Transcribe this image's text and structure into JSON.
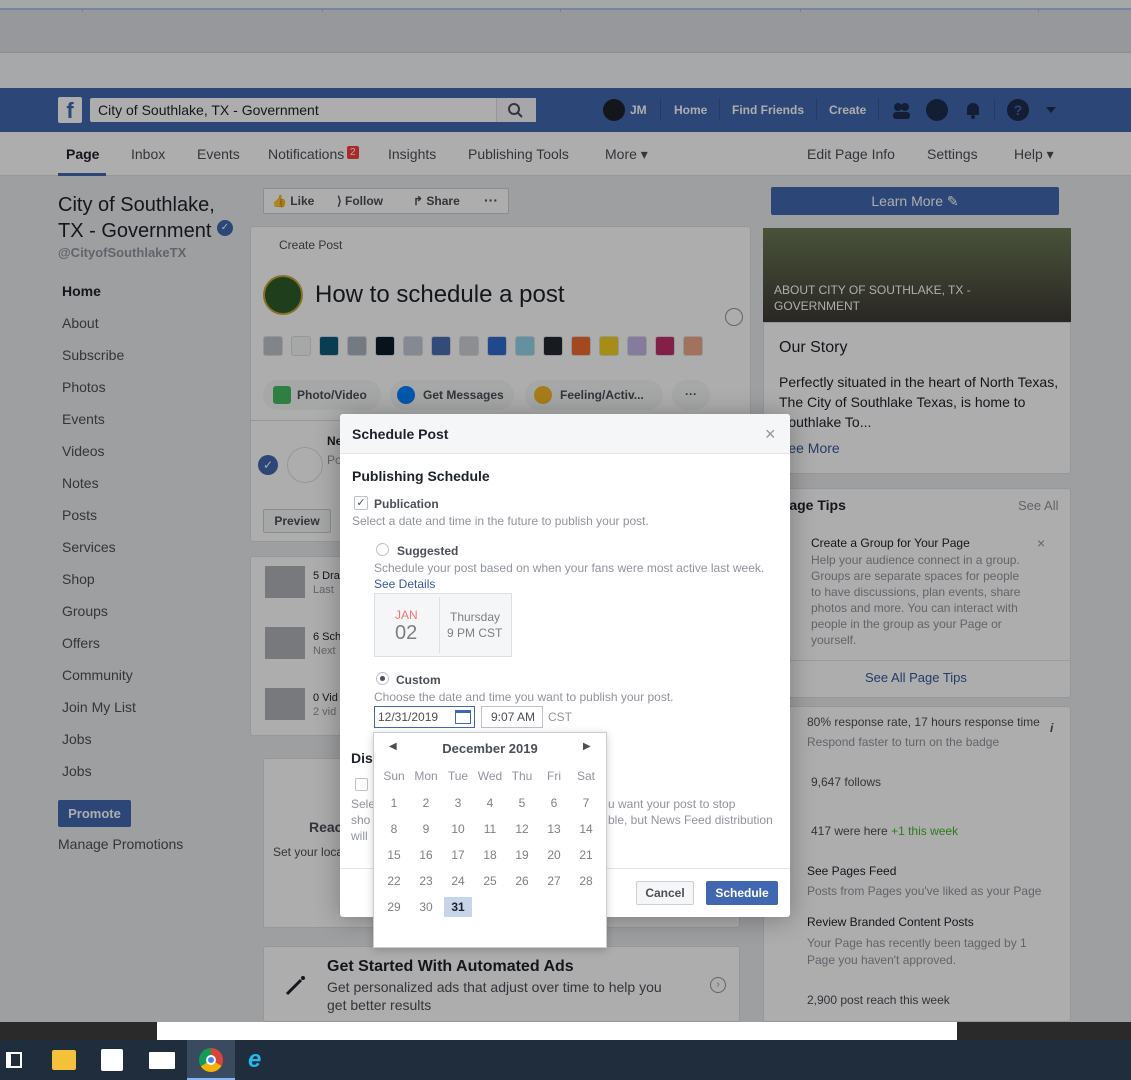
{
  "fb": {
    "search_value": "City of Southlake, TX - Government",
    "initials": "JM",
    "home": "Home",
    "find_friends": "Find Friends",
    "create": "Create"
  },
  "tabs": {
    "page": "Page",
    "inbox": "Inbox",
    "events": "Events",
    "notifications": "Notifications",
    "notif_count": "2",
    "insights": "Insights",
    "publishing": "Publishing Tools",
    "more": "More ▾",
    "edit_info": "Edit Page Info",
    "settings": "Settings",
    "help": "Help ▾"
  },
  "left": {
    "title": "City of Southlake, TX - Government",
    "handle": "@CityofSouthlakeTX",
    "nav": [
      "Home",
      "About",
      "Subscribe",
      "Photos",
      "Events",
      "Videos",
      "Notes",
      "Posts",
      "Services",
      "Shop",
      "Groups",
      "Offers",
      "Community",
      "Join My List",
      "Jobs",
      "Jobs"
    ],
    "promote": "Promote",
    "manage": "Manage Promotions"
  },
  "actions": {
    "like": "Like",
    "follow": "Follow",
    "share": "Share",
    "more": "···"
  },
  "post": {
    "header": "Create Post",
    "text": "How to schedule a post",
    "photo": "Photo/Video",
    "messages": "Get Messages",
    "feeling": "Feeling/Activ...",
    "more": "···",
    "preview": "Preview",
    "news_label": "Ne",
    "pos_label": "Po"
  },
  "feed": {
    "drafts": "5 Dra",
    "drafts_sub": "Last",
    "sched": "6 Sch",
    "sched_sub": "Next",
    "videos": "0 Vid",
    "videos_sub": "2 vid",
    "reach": "Reac",
    "reach_sub": "Set your loca",
    "ads_title": "Get Started With Automated Ads",
    "ads_sub": "Get personalized ads that adjust over time to help you get better results"
  },
  "right": {
    "learn_more": "Learn More",
    "about_banner": "ABOUT CITY OF SOUTHLAKE, TX - GOVERNMENT",
    "our_story": "Our Story",
    "story_text": "Perfectly situated in the heart of North Texas, The City of Southlake Texas, is home to Southlake To...",
    "see_more": "See More",
    "tips_title": "Page Tips",
    "see_all": "See All",
    "tip_title": "Create a Group for Your Page",
    "tip_text": "Help your audience connect in a group. Groups are separate spaces for people to have discussions, plan events, share photos and more. You can interact with people in the group as your Page or yourself.",
    "see_all_tips": "See All Page Tips",
    "response": "80% response rate, 17 hours response time",
    "response_sub": "Respond faster to turn on the badge",
    "follows": "9,647 follows",
    "were_here": "417 were here",
    "this_week": "+1 this week",
    "see_feed": "See Pages Feed",
    "see_feed_sub": "Posts from Pages you've liked as your Page",
    "review": "Review Branded Content Posts",
    "review_sub": "Your Page has recently been tagged by 1 Page you haven't approved.",
    "reach": "2,900 post reach this week"
  },
  "modal": {
    "title": "Schedule Post",
    "close": "×",
    "section": "Publishing Schedule",
    "publication": "Publication",
    "pub_help": "Select a date and time in the future to publish your post.",
    "suggested": "Suggested",
    "sugg_help": "Schedule your post based on when your fans were most active last week.",
    "see_details": "See Details",
    "sugg_month": "JAN",
    "sugg_day": "02",
    "sugg_weekday": "Thursday",
    "sugg_time": "9 PM CST",
    "custom": "Custom",
    "custom_help": "Choose the date and time you want to publish your post.",
    "date_value": "12/31/2019",
    "time_value": "9:07 AM",
    "tz": "CST",
    "dis_label": "Dis",
    "partial_1": "u want your post to stop",
    "partial_2": "ble, but News Feed distribution",
    "partial_sel": "Sele",
    "partial_sho": "sho",
    "partial_will": "will",
    "cancel": "Cancel",
    "schedule": "Schedule"
  },
  "calendar": {
    "month": "December 2019",
    "dows": [
      "Sun",
      "Mon",
      "Tue",
      "Wed",
      "Thu",
      "Fri",
      "Sat"
    ],
    "weeks": [
      [
        "1",
        "2",
        "3",
        "4",
        "5",
        "6",
        "7"
      ],
      [
        "8",
        "9",
        "10",
        "11",
        "12",
        "13",
        "14"
      ],
      [
        "15",
        "16",
        "17",
        "18",
        "19",
        "20",
        "21"
      ],
      [
        "22",
        "23",
        "24",
        "25",
        "26",
        "27",
        "28"
      ],
      [
        "29",
        "30",
        "31"
      ]
    ],
    "selected": "31"
  }
}
